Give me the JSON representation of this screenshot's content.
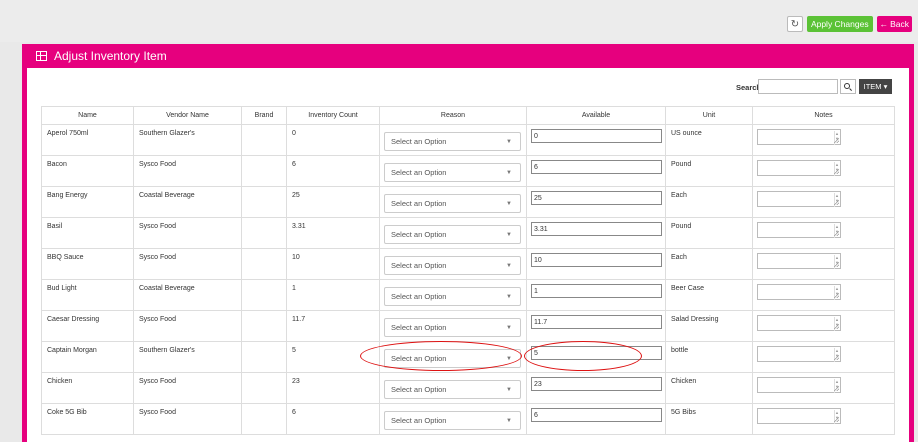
{
  "toolbar": {
    "refresh_icon": "refresh-icon",
    "apply_label": "Apply Changes",
    "back_label": "Back",
    "back_icon": "arrow-left-icon"
  },
  "panel": {
    "title": "Adjust Inventory Item",
    "title_icon": "table-grid-icon"
  },
  "search": {
    "label": "Search",
    "value": "",
    "item_button": "ITEM ▾"
  },
  "table": {
    "columns": [
      "Name",
      "Vendor Name",
      "Brand",
      "Inventory Count",
      "Reason",
      "Available",
      "Unit",
      "Notes"
    ],
    "select_placeholder": "Select an Option",
    "rows": [
      {
        "name": "Aperol 750ml",
        "vendor": "Southern Glazer's",
        "brand": "",
        "count": "0",
        "reason": "Select an Option",
        "available": "0",
        "unit": "US ounce",
        "notes": ""
      },
      {
        "name": "Bacon",
        "vendor": "Sysco Food",
        "brand": "",
        "count": "6",
        "reason": "Select an Option",
        "available": "6",
        "unit": "Pound",
        "notes": ""
      },
      {
        "name": "Bang Energy",
        "vendor": "Coastal Beverage",
        "brand": "",
        "count": "25",
        "reason": "Select an Option",
        "available": "25",
        "unit": "Each",
        "notes": ""
      },
      {
        "name": "Basil",
        "vendor": "Sysco Food",
        "brand": "",
        "count": "3.31",
        "reason": "Select an Option",
        "available": "3.31",
        "unit": "Pound",
        "notes": ""
      },
      {
        "name": "BBQ Sauce",
        "vendor": "Sysco Food",
        "brand": "",
        "count": "10",
        "reason": "Select an Option",
        "available": "10",
        "unit": "Each",
        "notes": ""
      },
      {
        "name": "Bud Light",
        "vendor": "Coastal Beverage",
        "brand": "",
        "count": "1",
        "reason": "Select an Option",
        "available": "1",
        "unit": "Beer Case",
        "notes": ""
      },
      {
        "name": "Caesar Dressing",
        "vendor": "Sysco Food",
        "brand": "",
        "count": "11.7",
        "reason": "Select an Option",
        "available": "11.7",
        "unit": "Salad Dressing",
        "notes": ""
      },
      {
        "name": "Captain Morgan",
        "vendor": "Southern Glazer's",
        "brand": "",
        "count": "5",
        "reason": "Select an Option",
        "available": "5",
        "unit": "bottle",
        "notes": ""
      },
      {
        "name": "Chicken",
        "vendor": "Sysco Food",
        "brand": "",
        "count": "23",
        "reason": "Select an Option",
        "available": "23",
        "unit": "Chicken",
        "notes": ""
      },
      {
        "name": "Coke 5G Bib",
        "vendor": "Sysco Food",
        "brand": "",
        "count": "6",
        "reason": "Select an Option",
        "available": "6",
        "unit": "5G Bibs",
        "notes": ""
      }
    ]
  },
  "colors": {
    "accent": "#e6007e",
    "apply": "#5bc236",
    "highlight": "#dd1111"
  }
}
